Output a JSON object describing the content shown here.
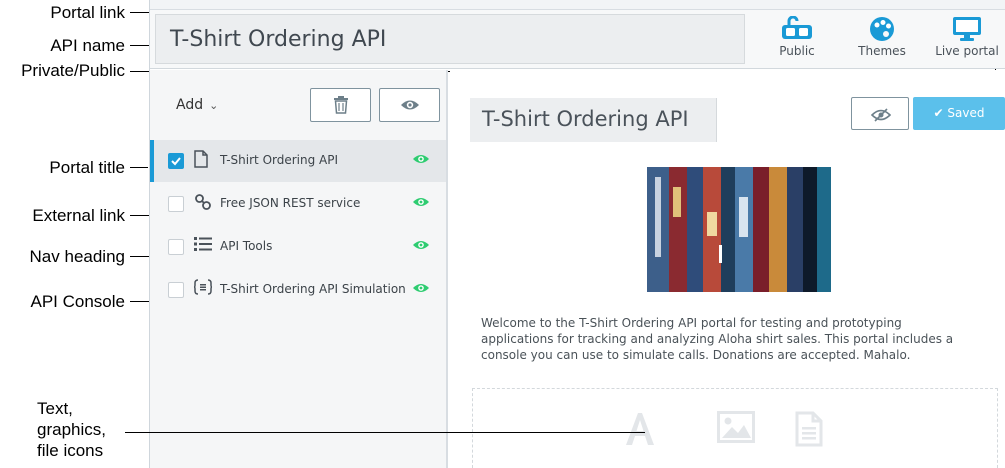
{
  "callouts": {
    "portal_link": "Portal link",
    "api_name": "API name",
    "private_public": "Private/Public",
    "portal_title": "Portal title",
    "external_link": "External link",
    "nav_heading": "Nav heading",
    "api_console": "API Console",
    "assets_line1": "Text,",
    "assets_line2": "graphics,",
    "assets_line3": "file icons"
  },
  "header": {
    "api_name": "T-Shirt Ordering API",
    "buttons": [
      {
        "label": "Public",
        "icon": "public-lock-icon",
        "color": "#1a9ad6"
      },
      {
        "label": "Themes",
        "icon": "palette-icon",
        "color": "#1a9ad6"
      },
      {
        "label": "Live portal",
        "icon": "monitor-icon",
        "color": "#1a9ad6"
      }
    ]
  },
  "sidebar": {
    "add_label": "Add",
    "items": [
      {
        "label": "T-Shirt Ordering API",
        "icon": "document-icon",
        "checked": true,
        "selected": true
      },
      {
        "label": "Free JSON REST service",
        "icon": "link-icon",
        "checked": false,
        "selected": false
      },
      {
        "label": "API Tools",
        "icon": "list-icon",
        "checked": false,
        "selected": false
      },
      {
        "label": "T-Shirt Ordering API Simulation",
        "icon": "console-icon",
        "checked": false,
        "selected": false
      }
    ]
  },
  "main": {
    "page_title": "T-Shirt Ordering API",
    "saved_label": "Saved",
    "welcome_text": "Welcome to the T-Shirt Ordering API portal for testing and prototyping applications for tracking and analyzing Aloha shirt sales. This portal includes a console you can use to simulate calls. Donations are accepted. Mahalo."
  },
  "colors": {
    "accent": "#1a9ad6",
    "visible_eye": "#2ecc71",
    "saved_button": "#5bc0eb"
  }
}
